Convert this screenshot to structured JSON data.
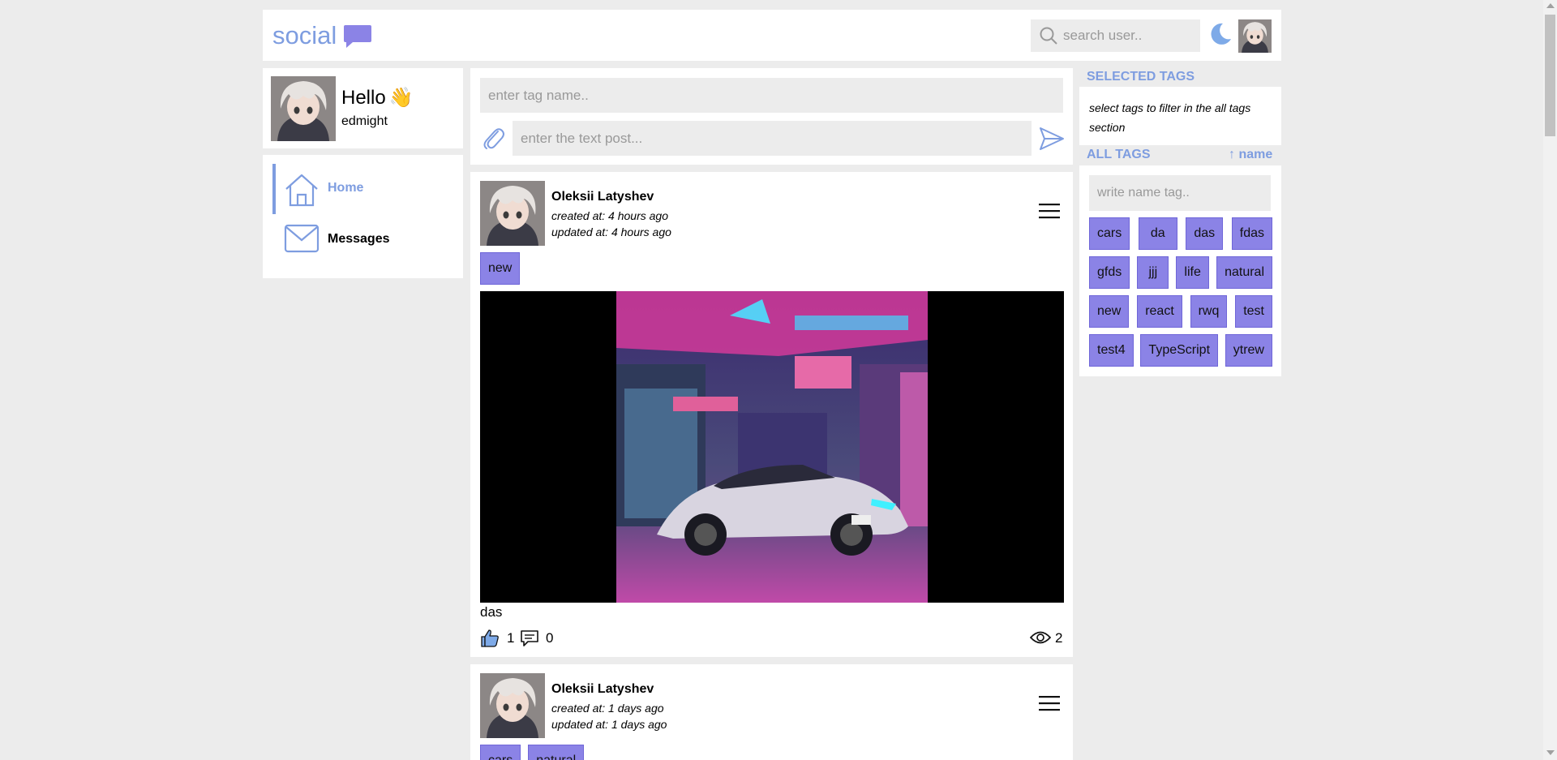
{
  "header": {
    "logo_text": "social",
    "search": {
      "placeholder": "search user.."
    }
  },
  "profile": {
    "greeting": "Hello",
    "wave": "👋",
    "username": "edmight"
  },
  "nav": {
    "items": [
      {
        "label": "Home",
        "icon": "home-icon",
        "active": true
      },
      {
        "label": "Messages",
        "icon": "envelope-icon",
        "active": false
      }
    ]
  },
  "composer": {
    "tag_placeholder": "enter tag name..",
    "text_placeholder": "enter the text post..."
  },
  "posts": [
    {
      "author": "Oleksii Latyshev",
      "created": "created at: 4 hours ago",
      "updated": "updated at: 4 hours ago",
      "tags": [
        "new"
      ],
      "text": "das",
      "likes": "1",
      "comments": "0",
      "views": "2"
    },
    {
      "author": "Oleksii Latyshev",
      "created": "created at: 1 days ago",
      "updated": "updated at: 1 days ago",
      "tags": [
        "cars",
        "natural"
      ]
    }
  ],
  "sidebar": {
    "selected_title": "SELECTED TAGS",
    "selected_hint": "select tags to filter in the all tags section",
    "all_title": "ALL TAGS",
    "sort_label": "↑ name",
    "filter_placeholder": "write name tag..",
    "tags": [
      "cars",
      "da",
      "das",
      "fdas",
      "gfds",
      "jjj",
      "life",
      "natural",
      "new",
      "react",
      "rwq",
      "test",
      "test4",
      "TypeScript",
      "ytrew"
    ]
  },
  "colors": {
    "accent": "#7e9de0",
    "tag_bg": "#8b83e6",
    "page_bg": "#ececec"
  }
}
